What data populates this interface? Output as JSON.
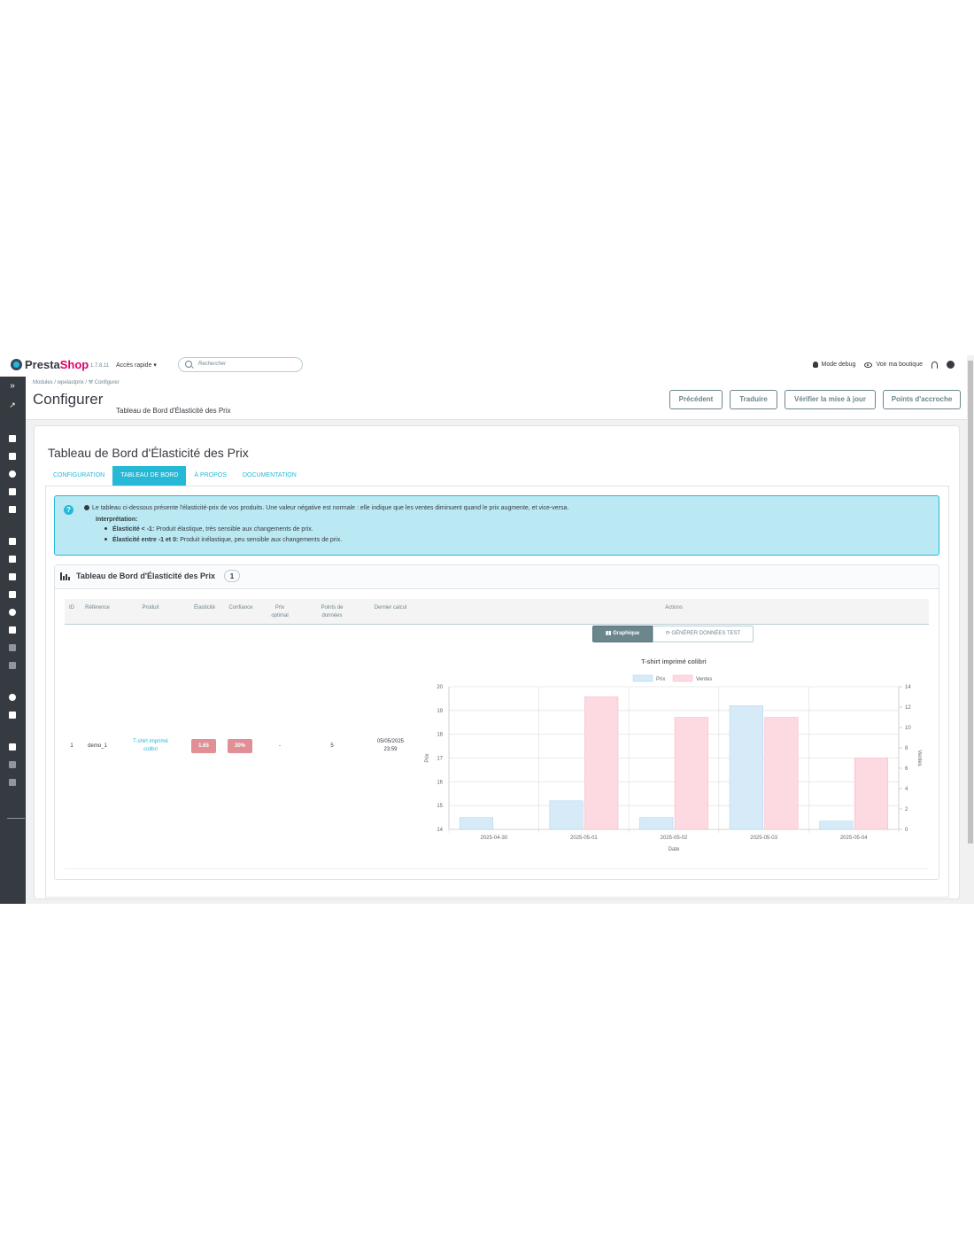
{
  "topbar": {
    "logo_a": "Presta",
    "logo_b": "Shop",
    "version": "1.7.8.11",
    "quick_access": "Accès rapide ▾",
    "search_placeholder": "Rechercher",
    "debug_mode": "Mode debug",
    "view_shop": "Voir ma boutique"
  },
  "header": {
    "breadcrumb": "Modules  /  wpelastprix  /  ⚒ Configurer",
    "title": "Configurer",
    "subtitle": "Tableau de Bord d'Élasticité des Prix",
    "buttons": {
      "previous": "Précédent",
      "translate": "Traduire",
      "check_update": "Vérifier la mise à jour",
      "hooks": "Points d'accroche"
    }
  },
  "card": {
    "title": "Tableau de Bord d'Élasticité des Prix",
    "tabs": [
      "CONFIGURATION",
      "TABLEAU DE BORD",
      "À PROPOS",
      "DOCUMENTATION"
    ],
    "active_tab": "TABLEAU DE BORD"
  },
  "alert": {
    "line1": "Le tableau ci-dessous présente l'élasticité-prix de vos produits. Une valeur négative est normale : elle indique que les ventes diminuent quand le prix augmente, et vice-versa.",
    "heading": "Interprétation:",
    "item1_bold": "Élasticité < -1:",
    "item1_text": " Produit élastique, très sensible aux changements de prix.",
    "item2_bold": "Élasticité entre -1 et 0:",
    "item2_text": " Produit inélastique, peu sensible aux changements de prix."
  },
  "panel": {
    "title": "Tableau de Bord d'Élasticité des Prix",
    "count": "1"
  },
  "table": {
    "headers": {
      "id": "ID",
      "reference": "Référence",
      "product": "Produit",
      "elasticity": "Élasticité",
      "confidence": "Confiance",
      "optimal_price_1": "Prix",
      "optimal_price_2": "optimal",
      "data_points_1": "Points de",
      "data_points_2": "données",
      "last_calc": "Dernier calcul",
      "actions": "Actions"
    },
    "row": {
      "id": "1",
      "reference": "demo_1",
      "product_1": "T-shirt imprimé",
      "product_2": "colibri",
      "elasticity": "1.65",
      "confidence": "30%",
      "optimal_price": "-",
      "data_points": "5",
      "last_calc_date": "05/05/2025",
      "last_calc_time": "23:59"
    }
  },
  "actions": {
    "graph_button": "Graphique",
    "generate_button": "GÉNÉRER DONNÉES TEST"
  },
  "colors": {
    "accent": "#25b9d7",
    "badge": "#e08f95",
    "prix_fill": "#d6eaf8",
    "ventes_fill": "#fdd9e1"
  },
  "chart_data": {
    "type": "bar",
    "title": "T-shirt imprimé colibri",
    "xlabel": "Date",
    "ylabel": "Prix",
    "y2label": "Ventes",
    "categories": [
      "2025-04-30",
      "2025-05-01",
      "2025-05-02",
      "2025-05-03",
      "2025-05-04"
    ],
    "series": [
      {
        "name": "Prix",
        "axis": "left",
        "values": [
          14.5,
          15.2,
          14.5,
          19.2,
          14.35
        ]
      },
      {
        "name": "Ventes",
        "axis": "right",
        "values": [
          0,
          13,
          11,
          11,
          7
        ]
      }
    ],
    "ylim": [
      14,
      20
    ],
    "y2lim": [
      0,
      14
    ],
    "yticks": [
      14,
      15,
      16,
      17,
      18,
      19,
      20
    ],
    "y2ticks": [
      0,
      2,
      4,
      6,
      8,
      10,
      12,
      14
    ],
    "legend": "top",
    "grid": true
  }
}
